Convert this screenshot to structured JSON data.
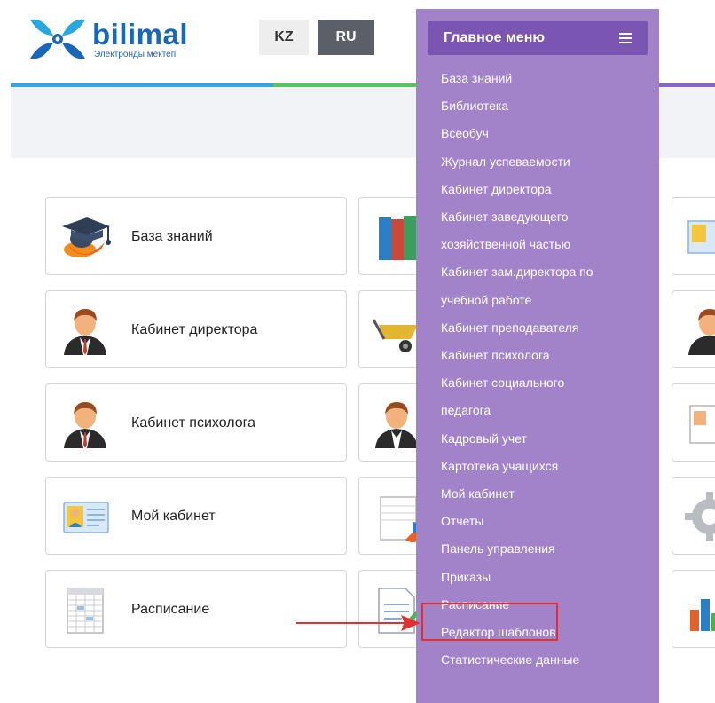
{
  "brand": {
    "name": "bilimal",
    "subtitle": "Электронды мектеп",
    "color": "#1a66b8"
  },
  "languages": [
    {
      "code": "KZ",
      "active": false
    },
    {
      "code": "RU",
      "active": true
    }
  ],
  "colors": {
    "menu_bg": "#a282c8",
    "menu_header_bg": "#7a55b1",
    "highlight": "#e03030",
    "stripe_blue": "#3aa3e3",
    "stripe_green": "#5bc35e",
    "stripe_purple": "#8b63c4"
  },
  "main_menu": {
    "title": "Главное меню",
    "icon": "hamburger-icon",
    "items": [
      "База знаний",
      "Библиотека",
      "Всеобуч",
      "Журнал успеваемости",
      "Кабинет директора",
      "Кабинет заведующего",
      "хозяйственной частью",
      "Кабинет зам.директора по",
      "учебной работе",
      "Кабинет преподавателя",
      "Кабинет психолога",
      "Кабинет социального",
      "педагога",
      "Кадровый учет",
      "Картотека учащихся",
      "Мой кабинет",
      "Отчеты",
      "Панель управления",
      "Приказы",
      "Расписание",
      "Редактор шаблонов",
      "Статистические данные"
    ],
    "highlighted_item": "Расписание"
  },
  "tiles": [
    {
      "label": "База знаний",
      "icon": "graduation-cap-icon"
    },
    {
      "label": "Кабинет директора",
      "icon": "person-avatar-icon"
    },
    {
      "label": "Кабинет психолога",
      "icon": "person-avatar-icon"
    },
    {
      "label": "Мой кабинет",
      "icon": "id-card-icon"
    },
    {
      "label": "Расписание",
      "icon": "spreadsheet-icon"
    }
  ],
  "partial_tiles": [
    {
      "icon": "books-icon"
    },
    {
      "icon": "wheelbarrow-icon"
    },
    {
      "icon": "person-avatar-icon"
    },
    {
      "icon": "report-chart-icon"
    },
    {
      "icon": "document-edit-icon"
    }
  ],
  "right_tiles": [
    {
      "icon": "contacts-icon"
    },
    {
      "icon": "person-avatar-icon"
    },
    {
      "icon": "id-card-icon"
    },
    {
      "icon": "gear-icon"
    },
    {
      "icon": "bar-chart-icon"
    }
  ]
}
